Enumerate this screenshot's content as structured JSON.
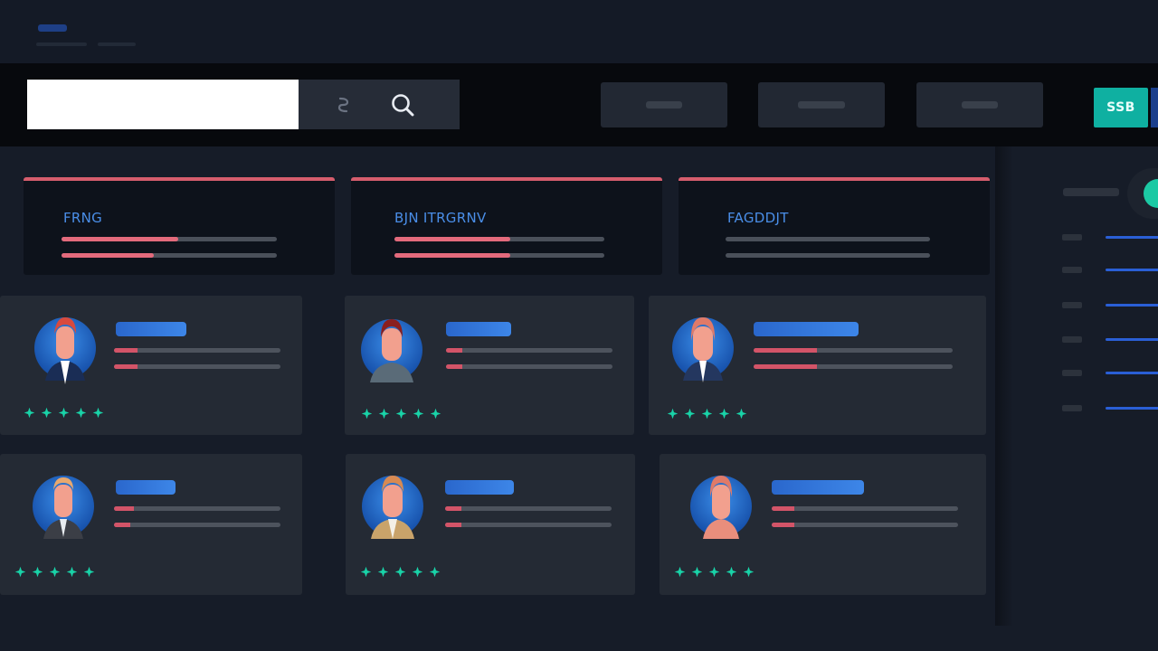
{
  "toolbar": {
    "search_placeholder": "",
    "accent_button_label": "SSB",
    "buttons": [
      "view-filter-1",
      "view-filter-2",
      "view-filter-3"
    ]
  },
  "summary_panels": [
    {
      "title": "FRNG",
      "bars": [
        0.56,
        0.43
      ]
    },
    {
      "title": "BJN ITRGRNV",
      "bars": [
        0.55,
        0.55
      ]
    },
    {
      "title": "FAGDDJT",
      "bars": [
        0,
        0
      ]
    }
  ],
  "profiles": [
    {
      "rating": 5,
      "line_fill": [
        0.0,
        0.12
      ]
    },
    {
      "rating": 5,
      "line_fill": [
        0.0,
        0.0
      ]
    },
    {
      "rating": 5,
      "line_fill": [
        0.3,
        0.3
      ]
    },
    {
      "rating": 5,
      "line_fill": [
        0.1,
        0.08
      ]
    },
    {
      "rating": 5,
      "line_fill": [
        0.1,
        0.1
      ]
    },
    {
      "rating": 5,
      "line_fill": [
        0.1,
        0.1
      ]
    }
  ],
  "icons": {
    "search": "search-icon",
    "filter": "filter-icon",
    "star": "star-icon",
    "avatar": "avatar-icon",
    "toggle": "toggle-switch"
  },
  "colors": {
    "accent_teal": "#0fb0a1",
    "toggle_on": "#1cc9a4",
    "panel_top_border": "#d65d6d",
    "progress_fill": "#e36a7c",
    "title_blue": "#4a8ee8",
    "name_bar_blue": "#2f6fd3",
    "star_green": "#19d3a8"
  },
  "side_list": {
    "toggle_on": true,
    "rows": 6
  }
}
